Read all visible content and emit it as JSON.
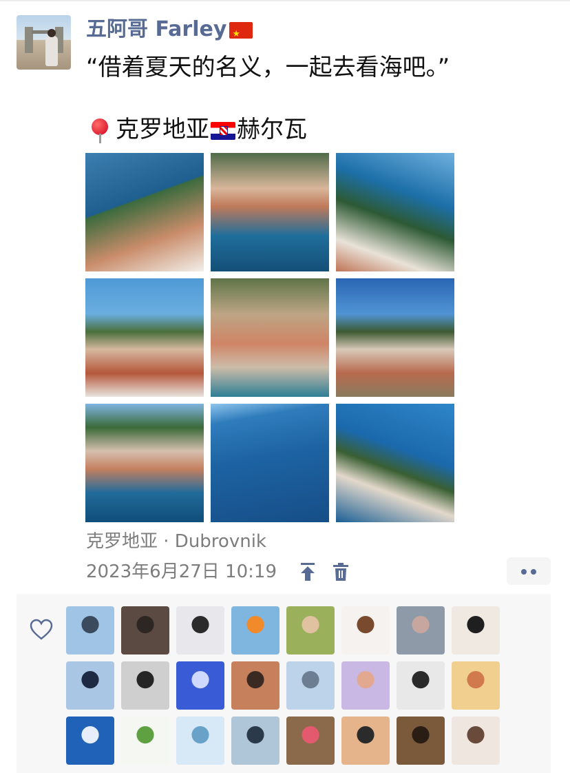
{
  "post": {
    "author": "五阿哥 Farley",
    "text": "“借着夏天的名义，一起去看海吧。”",
    "location_before_flag": "克罗地亚",
    "location_after_flag": "赫尔瓦",
    "location_meta": "克罗地亚 · Dubrovnik",
    "timestamp": "2023年6月27日 10:19"
  },
  "icons": {
    "author_flag": "china-flag-icon",
    "location_pin": "round-pushpin-icon",
    "location_flag": "croatia-flag-icon",
    "pin_top": "pin-to-top-icon",
    "delete": "trash-icon",
    "more": "more-options-icon",
    "like": "heart-outline-icon"
  },
  "colors": {
    "name_link": "#576b95",
    "meta_text": "#7d7d7d",
    "likes_panel_bg": "#f7f7f7"
  },
  "photos": [
    {
      "name": "photo-harbor-aerial-1"
    },
    {
      "name": "photo-harbor-aerial-2"
    },
    {
      "name": "photo-harbor-aerial-3"
    },
    {
      "name": "photo-town-view-1"
    },
    {
      "name": "photo-town-fortress"
    },
    {
      "name": "photo-town-view-2"
    },
    {
      "name": "photo-bay-boats"
    },
    {
      "name": "photo-open-sea"
    },
    {
      "name": "photo-peninsula"
    }
  ],
  "likers": [
    {
      "name": "liker-avatar-1"
    },
    {
      "name": "liker-avatar-2"
    },
    {
      "name": "liker-avatar-3"
    },
    {
      "name": "liker-avatar-4"
    },
    {
      "name": "liker-avatar-5"
    },
    {
      "name": "liker-avatar-6"
    },
    {
      "name": "liker-avatar-7"
    },
    {
      "name": "liker-avatar-8"
    },
    {
      "name": "liker-avatar-9"
    },
    {
      "name": "liker-avatar-10"
    },
    {
      "name": "liker-avatar-11"
    },
    {
      "name": "liker-avatar-12"
    },
    {
      "name": "liker-avatar-13"
    },
    {
      "name": "liker-avatar-14"
    },
    {
      "name": "liker-avatar-15"
    },
    {
      "name": "liker-avatar-16"
    },
    {
      "name": "liker-avatar-17"
    },
    {
      "name": "liker-avatar-18"
    },
    {
      "name": "liker-avatar-19"
    },
    {
      "name": "liker-avatar-20"
    },
    {
      "name": "liker-avatar-21"
    },
    {
      "name": "liker-avatar-22"
    },
    {
      "name": "liker-avatar-23"
    },
    {
      "name": "liker-avatar-24"
    }
  ]
}
